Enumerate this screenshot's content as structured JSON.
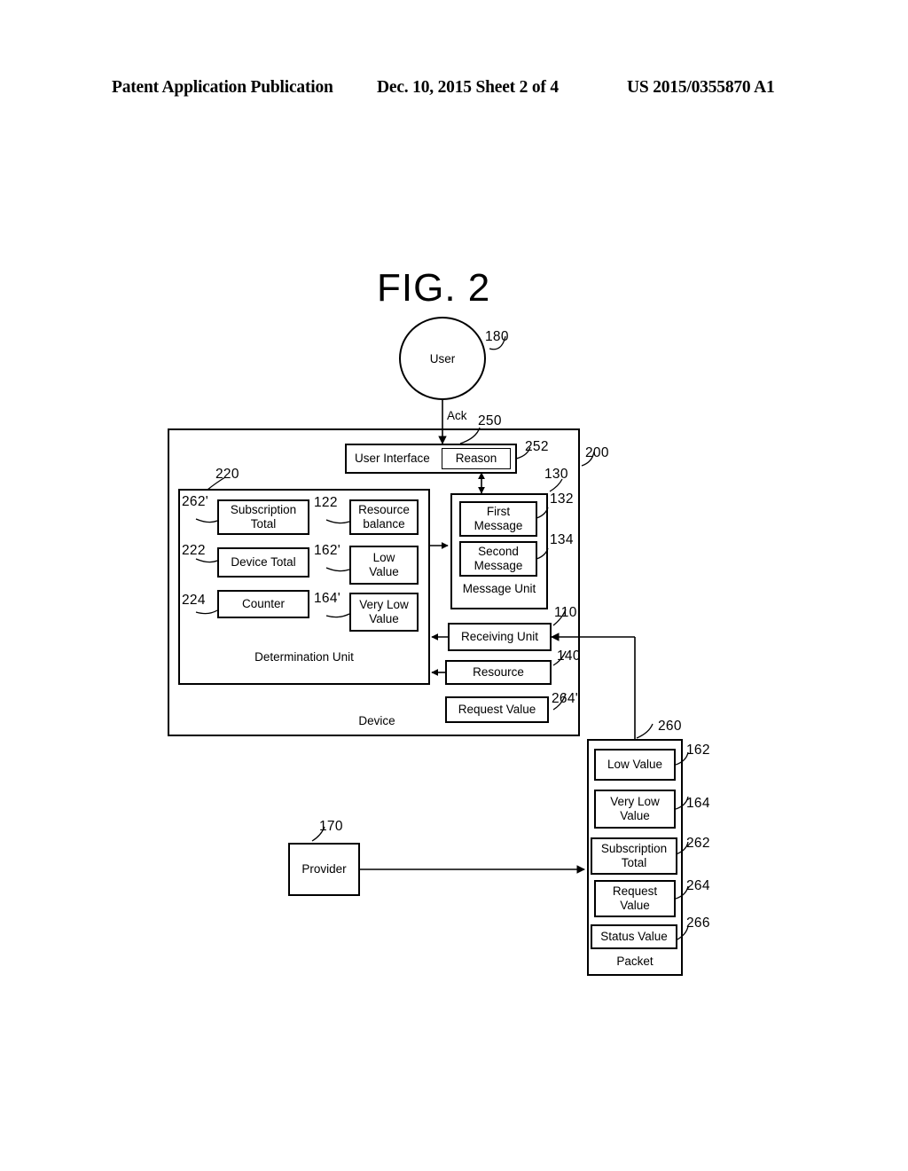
{
  "header": {
    "left": "Patent Application Publication",
    "middle": "Dec. 10, 2015  Sheet 2 of 4",
    "right": "US 2015/0355870 A1"
  },
  "figure": {
    "title": "FIG. 2",
    "actor": {
      "label": "User",
      "ref": "180"
    },
    "ack_edge": {
      "label": "Ack",
      "ref": "250"
    },
    "device": {
      "label": "Device",
      "ref": "200",
      "user_interface": {
        "label": "User Interface",
        "reason": {
          "label": "Reason",
          "ref": "252"
        }
      },
      "determination_unit": {
        "label": "Determination Unit",
        "ref": "220",
        "left_column": [
          {
            "label": "Subscription\nTotal",
            "ref": "262'"
          },
          {
            "label": "Device Total",
            "ref": "222"
          },
          {
            "label": "Counter",
            "ref": "224"
          }
        ],
        "right_column": [
          {
            "label": "Resource\nbalance",
            "ref": "122"
          },
          {
            "label": "Low\nValue",
            "ref": "162'"
          },
          {
            "label": "Very Low\nValue",
            "ref": "164'"
          }
        ]
      },
      "message_unit": {
        "label": "Message Unit",
        "ref": "130",
        "messages": [
          {
            "label": "First\nMessage",
            "ref": "132"
          },
          {
            "label": "Second\nMessage",
            "ref": "134"
          }
        ]
      },
      "receiving_unit": {
        "label": "Receiving Unit",
        "ref": "110"
      },
      "resource": {
        "label": "Resource",
        "ref": "140"
      },
      "request_value": {
        "label": "Request Value",
        "ref": "264'"
      }
    },
    "packet": {
      "label": "Packet",
      "ref": "260",
      "fields": [
        {
          "label": "Low Value",
          "ref": "162"
        },
        {
          "label": "Very Low\nValue",
          "ref": "164"
        },
        {
          "label": "Subscription\nTotal",
          "ref": "262"
        },
        {
          "label": "Request\nValue",
          "ref": "264"
        },
        {
          "label": "Status Value",
          "ref": "266"
        }
      ]
    },
    "provider": {
      "label": "Provider",
      "ref": "170"
    }
  },
  "colors": {
    "ink": "#000000",
    "paper": "#ffffff"
  }
}
